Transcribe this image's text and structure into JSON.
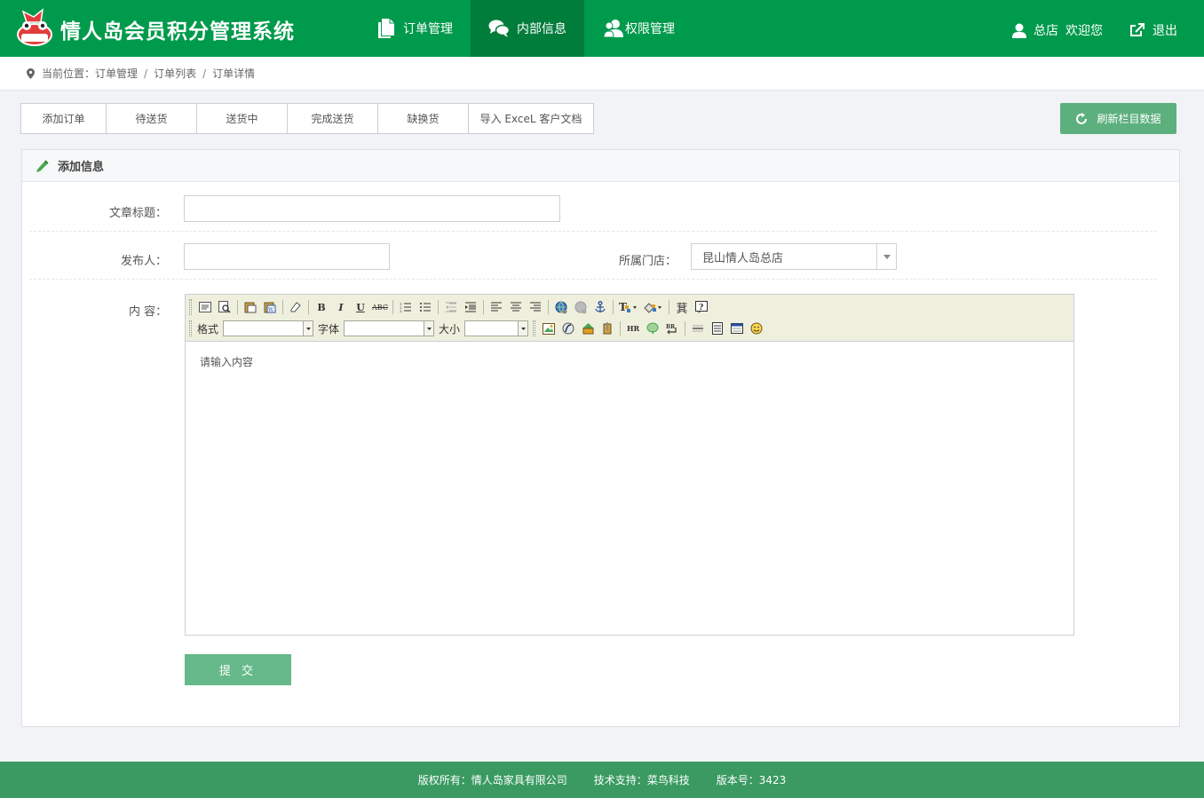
{
  "app": {
    "title": "情人岛会员积分管理系统",
    "logo_text": "情人岛",
    "brand_color": "#009a4c",
    "nav_active_color": "#007c3b"
  },
  "nav": [
    {
      "label": "订单管理",
      "icon": "document-icon",
      "active": false
    },
    {
      "label": "内部信息",
      "icon": "chat-bubble-icon",
      "active": true
    },
    {
      "label": "权限管理",
      "icon": "users-icon",
      "active": false
    }
  ],
  "user": {
    "store": "总店",
    "greeting": "欢迎您",
    "logout_label": "退出"
  },
  "breadcrumb": {
    "prefix": "当前位置：",
    "items": [
      "订单管理",
      "订单列表",
      "订单详情"
    ]
  },
  "tabs": [
    {
      "label": "添加订单"
    },
    {
      "label": "待送货"
    },
    {
      "label": "送货中"
    },
    {
      "label": "完成送货"
    },
    {
      "label": "缺换货"
    },
    {
      "label": "导入 ExceL 客户文档"
    }
  ],
  "refresh_label": "刷新栏目数据",
  "panel": {
    "title": "添加信息"
  },
  "form": {
    "title_label": "文章标题：",
    "title_value": "",
    "publisher_label": "发布人：",
    "publisher_value": "",
    "store_label": "所属门店：",
    "store_selected": "昆山情人岛总店",
    "content_label": "内  容：",
    "content_placeholder": "请输入内容",
    "submit_label": "提 交"
  },
  "editor": {
    "format_label": "格式",
    "font_label": "字体",
    "size_label": "大小"
  },
  "footer": {
    "copyright": "版权所有：情人岛家具有限公司",
    "support": "技术支持：菜鸟科技",
    "version": "版本号：3423"
  }
}
